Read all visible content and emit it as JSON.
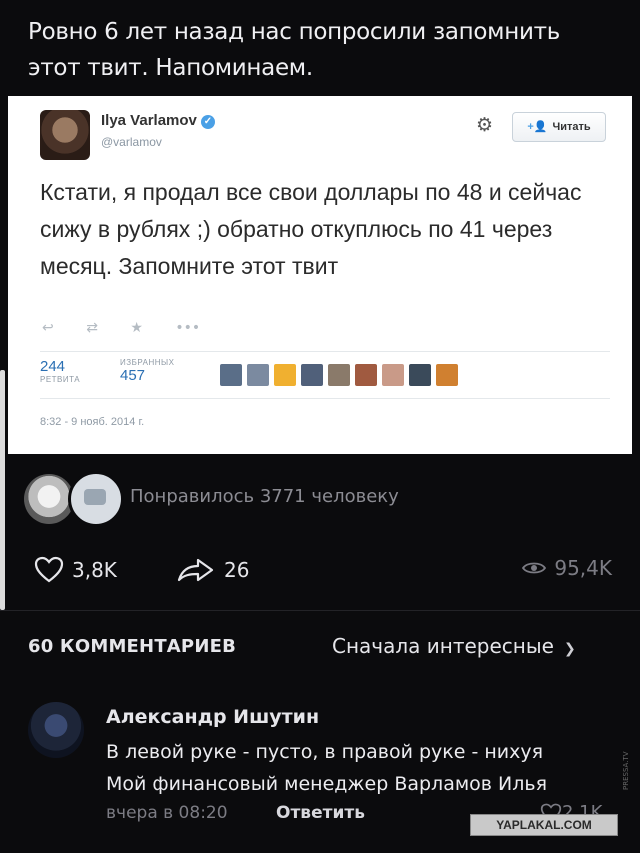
{
  "post": {
    "text": "Ровно 6 лет назад нас попросили запомнить этот твит. Напоминаем."
  },
  "tweet": {
    "name": "Ilya Varlamov",
    "handle": "@varlamov",
    "follow_label": "Читать",
    "body": "Кстати, я продал все свои доллары по 48 и сейчас сижу в рублях ;) обратно откуплюсь по 41 через месяц. Запомните этот твит",
    "retweets": "244",
    "retweets_label": "РЕТВИТА",
    "favorites": "457",
    "favorites_label": "ИЗБРАННЫХ",
    "date": "8:32 - 9 нояб. 2014 г."
  },
  "likes": {
    "text": "Понравилось 3771 человеку"
  },
  "actions": {
    "likes": "3,8K",
    "shares": "26",
    "views": "95,4K"
  },
  "comments": {
    "count_label": "60 КОММЕНТАРИЕВ",
    "sort_label": "Сначала интересные",
    "items": [
      {
        "author": "Александр Ишутин",
        "text_line1": "В левой руке - пусто, в правой руке - нихуя",
        "text_line2": "Мой финансовый менеджер Варламов Илья",
        "time": "вчера в 08:20",
        "reply_label": "Ответить",
        "likes": "2,1K"
      }
    ]
  },
  "watermark": {
    "text": "YAPLAKAL.COM",
    "side": "PRESSA.TV"
  },
  "colors": {
    "background": "#0b0b0d",
    "accent": "#4aa0e6"
  }
}
